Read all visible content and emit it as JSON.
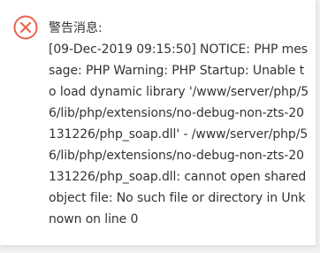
{
  "dialog": {
    "icon": "error-circle-x-icon",
    "accent_color": "#e8644e",
    "title": "警告消息:",
    "message": "[09-Dec-2019 09:15:50] NOTICE: PHP message: PHP Warning: PHP Startup: Unable to load dynamic library '/www/server/php/56/lib/php/extensions/no-debug-non-zts-20131226/php_soap.dll' - /www/server/php/56/lib/php/extensions/no-debug-non-zts-20131226/php_soap.dll: cannot open shared object file: No such file or directory in Unknown on line 0"
  }
}
